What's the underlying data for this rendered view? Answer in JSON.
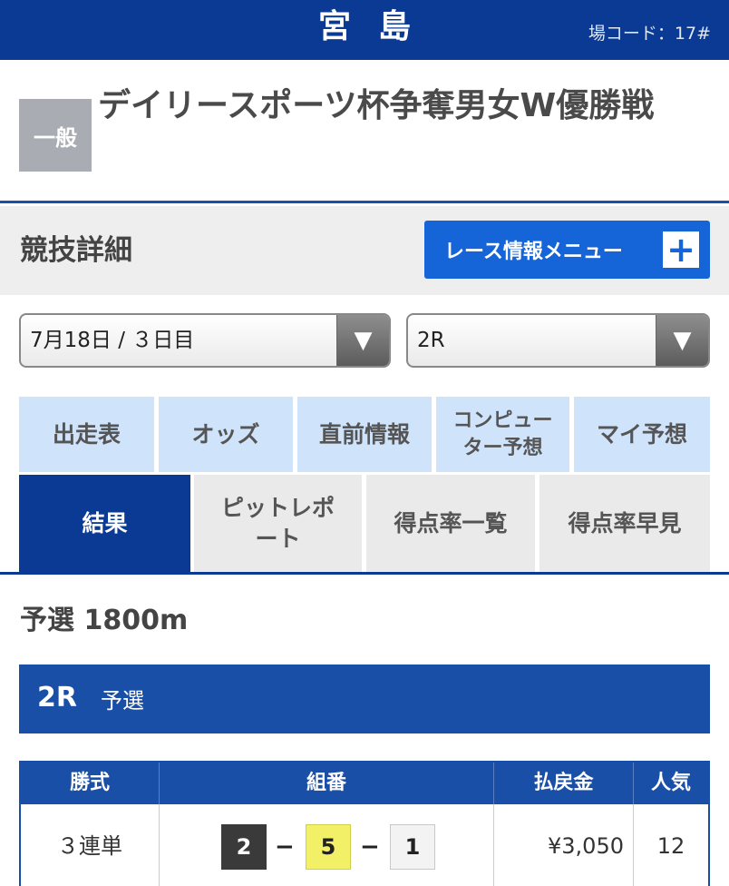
{
  "header": {
    "venue": "宮島",
    "venue_code": "場コード：17#"
  },
  "race": {
    "grade": "一般",
    "title": "デイリースポーツ杯争奪男女W優勝戦"
  },
  "detail": {
    "title": "競技詳細",
    "menu_label": "レース情報メニュー",
    "menu_icon": "plus-icon"
  },
  "selects": {
    "date": "7月18日 / ３日目",
    "race": "2R",
    "arrow_icon": "triangle-down-icon"
  },
  "tabs_row1": [
    {
      "label": "出走表"
    },
    {
      "label": "オッズ"
    },
    {
      "label": "直前情報"
    },
    {
      "label": "コンピューター予想"
    },
    {
      "label": "マイ予想"
    }
  ],
  "tabs_row2": [
    {
      "label": "結果",
      "active": true
    },
    {
      "label": "ピットレポート"
    },
    {
      "label": "得点率一覧"
    },
    {
      "label": "得点率早見"
    }
  ],
  "race_info": {
    "distance": "予選 1800m",
    "race_number": "2R",
    "race_class": "予選"
  },
  "results": {
    "headers": [
      "勝式",
      "組番",
      "払戻金",
      "人気"
    ],
    "rows": [
      {
        "type": "３連単",
        "combo": [
          "2",
          "5",
          "1"
        ],
        "dash": "−",
        "payout": "¥3,050",
        "popularity": "12"
      }
    ]
  },
  "colors": {
    "primary": "#0a3a94",
    "accent": "#1565d8",
    "tab_bg": "#cfe3fa",
    "badge": "#a9adb3"
  }
}
